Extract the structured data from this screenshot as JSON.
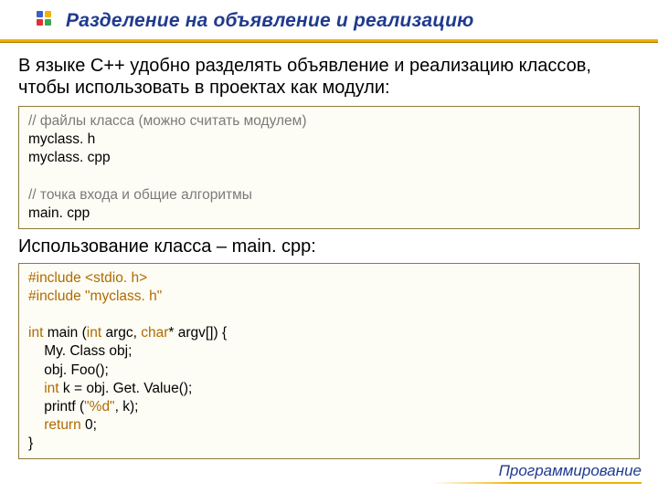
{
  "title": "Разделение на объявление и реализацию",
  "intro": "В языке С++ удобно разделять объявление и реализацию классов, чтобы использовать в проектах как модули:",
  "box1_comment1": "// файлы класса (можно считать модулем)",
  "box1_line1": "myclass. h",
  "box1_line2": "myclass. cpp",
  "box1_blank": "",
  "box1_comment2": "// точка входа и общие алгоритмы",
  "box1_line3": "main. cpp",
  "subtitle": "Использование класса – main. cpp:",
  "box2_l1": "#include <stdio. h>",
  "box2_l2": "#include \"myclass. h\"",
  "box2_blank": "",
  "box2_l3a": "int ",
  "box2_l3b": "main (",
  "box2_l3c": "int ",
  "box2_l3d": "argc, ",
  "box2_l3e": "char",
  "box2_l3f": "* argv[]) {",
  "box2_l4": "    My. Class obj;",
  "box2_l5": "    obj. Foo();",
  "box2_l6a": "    int ",
  "box2_l6b": "k = obj. Get. Value();",
  "box2_l7a": "    printf (",
  "box2_l7b": "\"%d\"",
  "box2_l7c": ", k);",
  "box2_l8a": "    return ",
  "box2_l8b": "0;",
  "box2_l9": "}",
  "footer": "Программирование"
}
